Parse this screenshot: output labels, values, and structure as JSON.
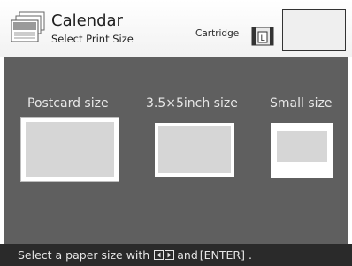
{
  "header": {
    "title": "Calendar",
    "subtitle": "Select Print Size",
    "cartridge_label": "Cartridge",
    "cartridge_size": "L",
    "app_icon": "calendar-stack-icon"
  },
  "sizes": [
    {
      "label": "Postcard size",
      "selected": true
    },
    {
      "label": "3.5×5inch size",
      "selected": false
    },
    {
      "label": "Small size",
      "selected": false
    }
  ],
  "footer": {
    "prefix": "Select a paper size with",
    "middle": "and",
    "enter_key": "[ENTER]",
    "suffix": "."
  },
  "colors": {
    "main_bg": "#5f5f5f",
    "footer_bg": "#2a2a2a",
    "card_inner": "#d6d6d6"
  }
}
